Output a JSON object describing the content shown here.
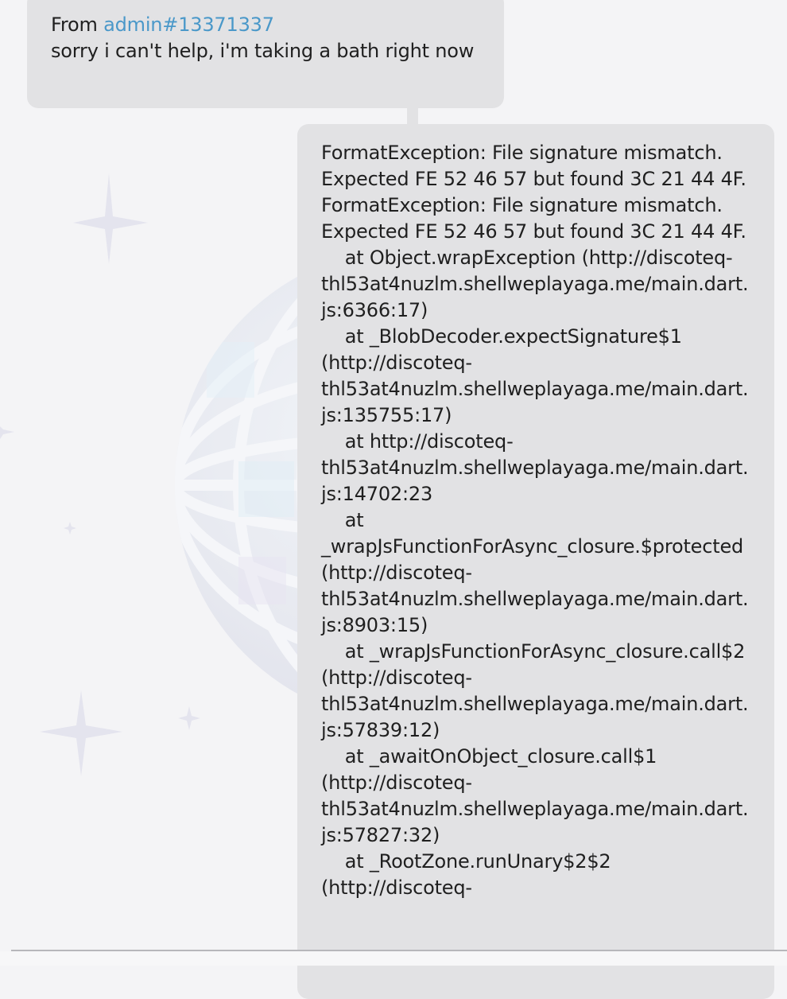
{
  "messages": [
    {
      "direction": "received",
      "sender_prefix": "From",
      "sender": "admin#13371337",
      "text": "sorry i can't help, i'm taking a bath right now"
    },
    {
      "direction": "sent",
      "text": "FormatException: File signature mismatch. Expected FE 52 46 57 but found 3C 21 44 4F. FormatException: File signature mismatch. Expected FE 52 46 57 but found 3C 21 44 4F.\n    at Object.wrapException (http://discoteq-thl53at4nuzlm.shellweplayaga.me/main.dart.js:6366:17)\n    at _BlobDecoder.expectSignature$1 (http://discoteq-thl53at4nuzlm.shellweplayaga.me/main.dart.js:135755:17)\n    at http://discoteq-thl53at4nuzlm.shellweplayaga.me/main.dart.js:14702:23\n    at _wrapJsFunctionForAsync_closure.$protected (http://discoteq-thl53at4nuzlm.shellweplayaga.me/main.dart.js:8903:15)\n    at _wrapJsFunctionForAsync_closure.call$2 (http://discoteq-thl53at4nuzlm.shellweplayaga.me/main.dart.js:57839:12)\n    at _awaitOnObject_closure.call$1 (http://discoteq-thl53at4nuzlm.shellweplayaga.me/main.dart.js:57827:32)\n    at _RootZone.runUnary$2$2 (http://discoteq-"
    }
  ],
  "background": {
    "decoration": "disco-ball-and-sparkles"
  },
  "colors": {
    "background": "#f4f4f6",
    "bubble": "#e2e2e4",
    "link": "#4a98c9",
    "text": "#1f1f1f"
  }
}
